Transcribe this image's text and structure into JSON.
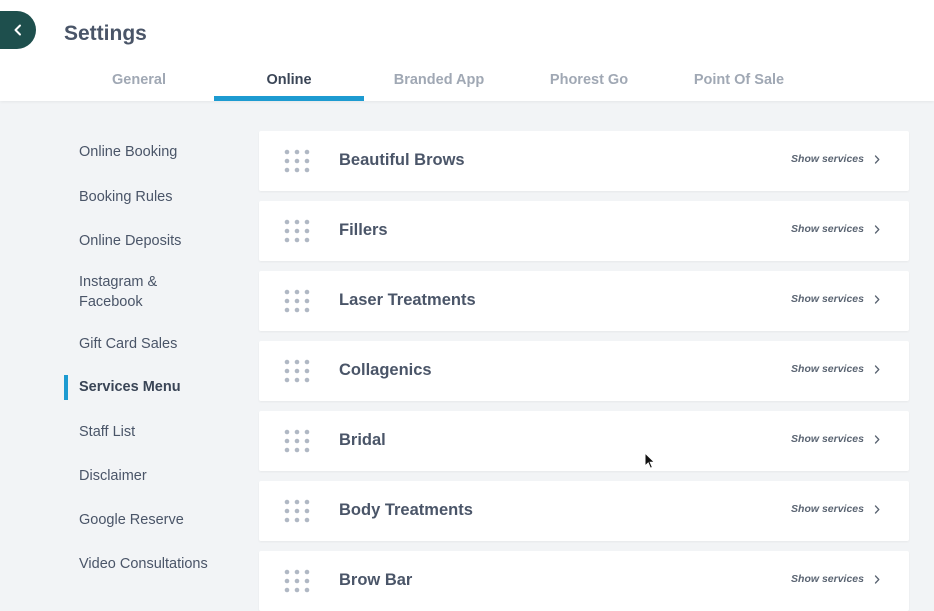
{
  "header": {
    "title": "Settings",
    "tabs": [
      {
        "label": "General"
      },
      {
        "label": "Online"
      },
      {
        "label": "Branded App"
      },
      {
        "label": "Phorest Go"
      },
      {
        "label": "Point Of Sale"
      }
    ],
    "active_tab": "Online"
  },
  "sidebar": {
    "items": [
      {
        "label": "Online Booking"
      },
      {
        "label": "Booking Rules"
      },
      {
        "label": "Online Deposits"
      },
      {
        "label": "Instagram & Facebook"
      },
      {
        "label": "Gift Card Sales"
      },
      {
        "label": "Services Menu"
      },
      {
        "label": "Staff List"
      },
      {
        "label": "Disclaimer"
      },
      {
        "label": "Google Reserve"
      },
      {
        "label": "Video Consultations"
      }
    ],
    "active_item": "Services Menu"
  },
  "categories": [
    {
      "name": "Beautiful Brows",
      "link": "Show services"
    },
    {
      "name": "Fillers",
      "link": "Show services"
    },
    {
      "name": "Laser Treatments",
      "link": "Show services"
    },
    {
      "name": "Collagenics",
      "link": "Show services"
    },
    {
      "name": "Bridal",
      "link": "Show services"
    },
    {
      "name": "Body Treatments",
      "link": "Show services"
    },
    {
      "name": "Brow Bar",
      "link": "Show services"
    }
  ],
  "colors": {
    "accent": "#1d9bd1",
    "back_button": "#1e4f4d",
    "background": "#f2f4f6"
  },
  "icons": {
    "back": "chevron-left-icon",
    "drag": "drag-handle-icon",
    "show": "chevron-right-icon",
    "cursor": "mouse-pointer-icon"
  }
}
